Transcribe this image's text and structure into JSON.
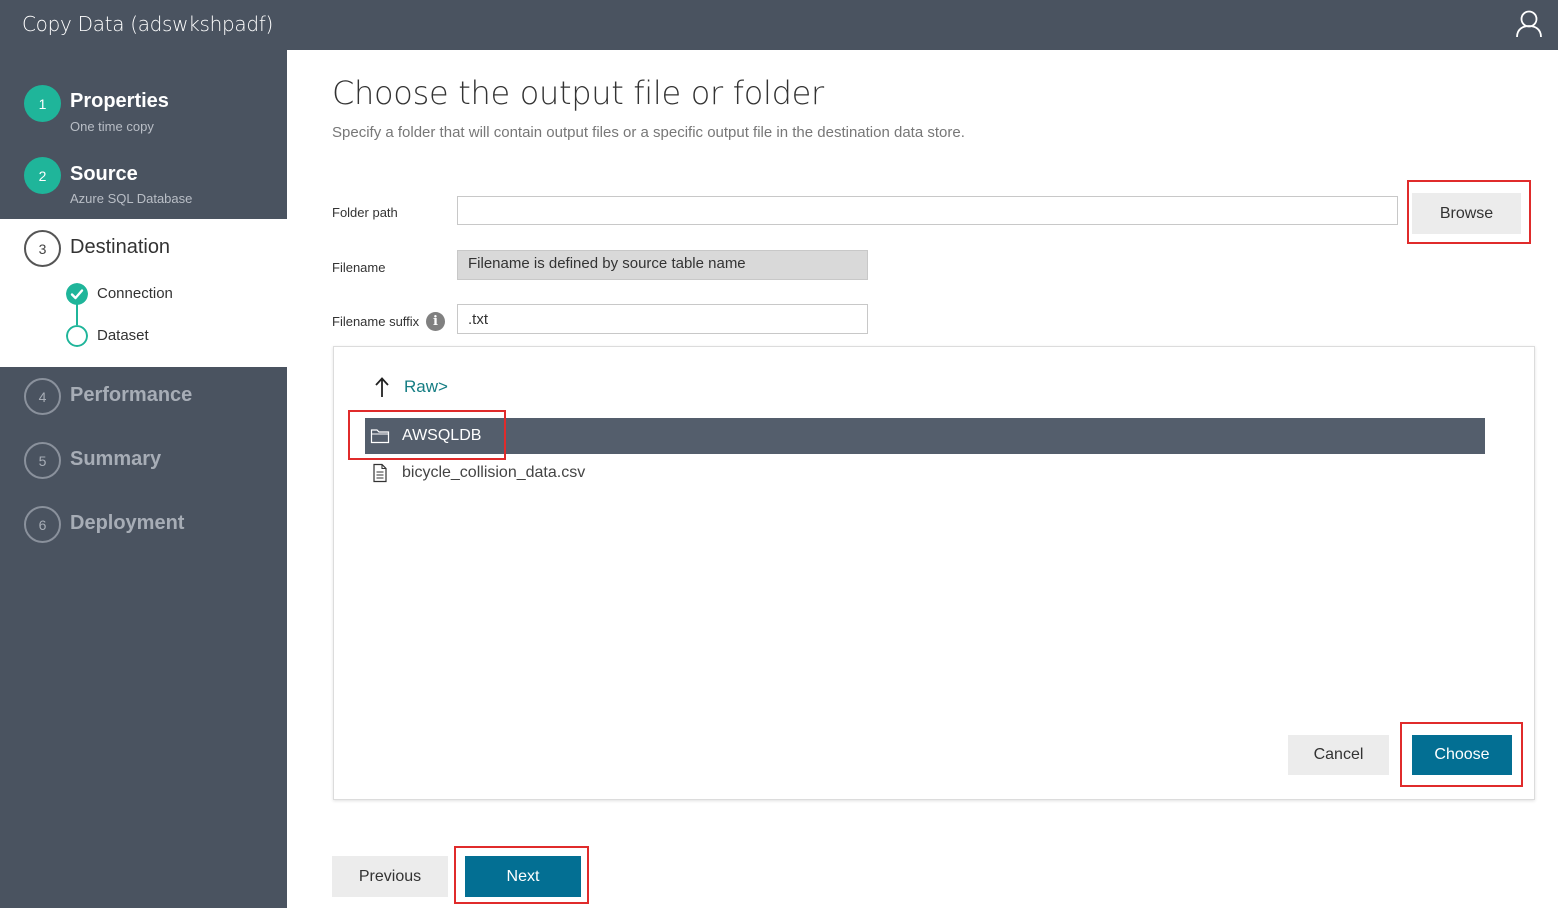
{
  "app": {
    "title": "Copy Data (adswkshpadf)"
  },
  "sidebar": {
    "steps": [
      {
        "number": "1",
        "name": "Properties",
        "sub": "One time copy",
        "state": "done"
      },
      {
        "number": "2",
        "name": "Source",
        "sub": "Azure SQL Database",
        "state": "done"
      },
      {
        "number": "3",
        "name": "Destination",
        "state": "current",
        "substeps": [
          {
            "label": "Connection",
            "state": "complete"
          },
          {
            "label": "Dataset",
            "state": "current"
          }
        ]
      },
      {
        "number": "4",
        "name": "Performance",
        "state": "future"
      },
      {
        "number": "5",
        "name": "Summary",
        "state": "future"
      },
      {
        "number": "6",
        "name": "Deployment",
        "state": "future"
      }
    ]
  },
  "main": {
    "title": "Choose the output file or folder",
    "subtitle": "Specify a folder that will contain output files or a specific output file in the destination data store.",
    "folder_path": {
      "label": "Folder path",
      "value": ""
    },
    "browse_label": "Browse",
    "filename": {
      "label": "Filename",
      "value": "Filename is defined by source table name"
    },
    "filename_suffix": {
      "label": "Filename suffix",
      "value": ".txt"
    },
    "info_glyph": "i"
  },
  "browser": {
    "breadcrumb": "Raw>",
    "items": [
      {
        "type": "folder",
        "name": "AWSQLDB",
        "selected": true
      },
      {
        "type": "file",
        "name": "bicycle_collision_data.csv",
        "selected": false
      }
    ],
    "cancel_label": "Cancel",
    "choose_label": "Choose"
  },
  "footer": {
    "previous_label": "Previous",
    "next_label": "Next"
  },
  "colors": {
    "sidebar_bg": "#4a5360",
    "step_done": "#1fb59a",
    "primary_button": "#036f93",
    "selected_row": "#545e6c",
    "highlight_box": "#e02b2b",
    "link": "#147d83"
  },
  "icons": {
    "user": "user-icon",
    "up": "up-arrow-icon",
    "folder": "folder-icon",
    "file": "file-icon",
    "check": "check-icon",
    "info": "info-icon"
  }
}
